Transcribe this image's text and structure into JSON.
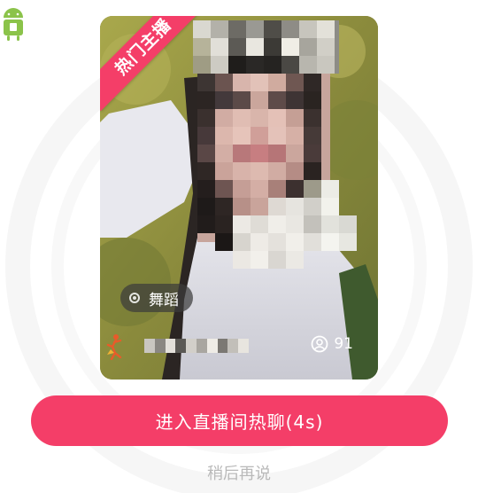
{
  "card": {
    "ribbon_label": "热门主播",
    "category_tag": "舞蹈",
    "viewer_count": "91"
  },
  "actions": {
    "enter_label": "进入直播间热聊(4s)",
    "later_label": "稍后再说"
  },
  "icons": {
    "app_badge": "android-app-icon",
    "tag_icon": "radio-dot-icon",
    "streamer_badge": "dancer-icon",
    "viewers_icon": "user-circle-icon"
  },
  "colors": {
    "accent": "#f43e68",
    "secondary_text": "#b9b9b9"
  }
}
